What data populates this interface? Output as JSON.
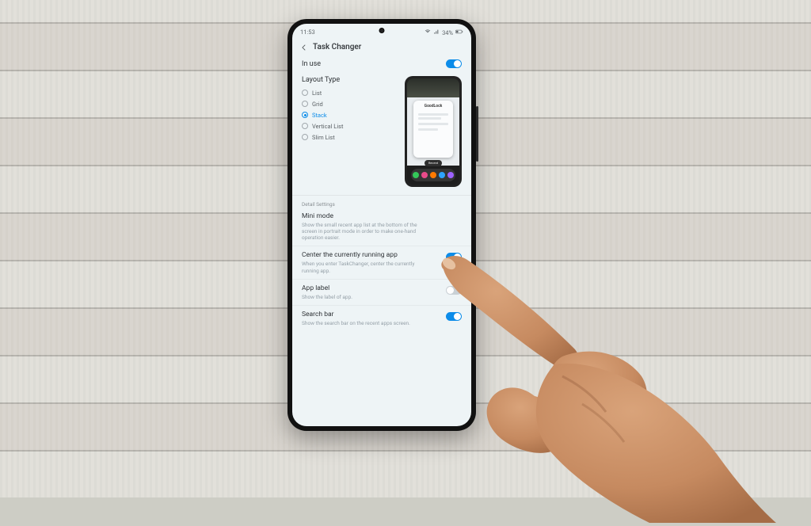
{
  "status": {
    "time": "11:53",
    "battery_text": "34%"
  },
  "header": {
    "title": "Task Changer"
  },
  "in_use": {
    "label": "In use",
    "on": true
  },
  "layout": {
    "title": "Layout Type",
    "options": [
      "List",
      "Grid",
      "Stack",
      "Vertical List",
      "Slim List"
    ],
    "selected": "Stack"
  },
  "preview": {
    "card_title": "GoodLock",
    "pill_label": "Recent"
  },
  "detail": {
    "caption": "Detail Settings",
    "items": [
      {
        "key": "mini_mode",
        "name": "Mini mode",
        "desc": "Show the small recent app list at the bottom of the screen in portrait mode in order to make one-hand operation easier.",
        "on": false,
        "has_toggle": false
      },
      {
        "key": "center_app",
        "name": "Center the currently running app",
        "desc": "When you enter TaskChanger, center the currently running app.",
        "on": true,
        "has_toggle": true
      },
      {
        "key": "app_label",
        "name": "App label",
        "desc": "Show the label of app.",
        "on": false,
        "has_toggle": true
      },
      {
        "key": "search_bar",
        "name": "Search bar",
        "desc": "Show the search bar on the recent apps screen.",
        "on": true,
        "has_toggle": true
      }
    ]
  }
}
